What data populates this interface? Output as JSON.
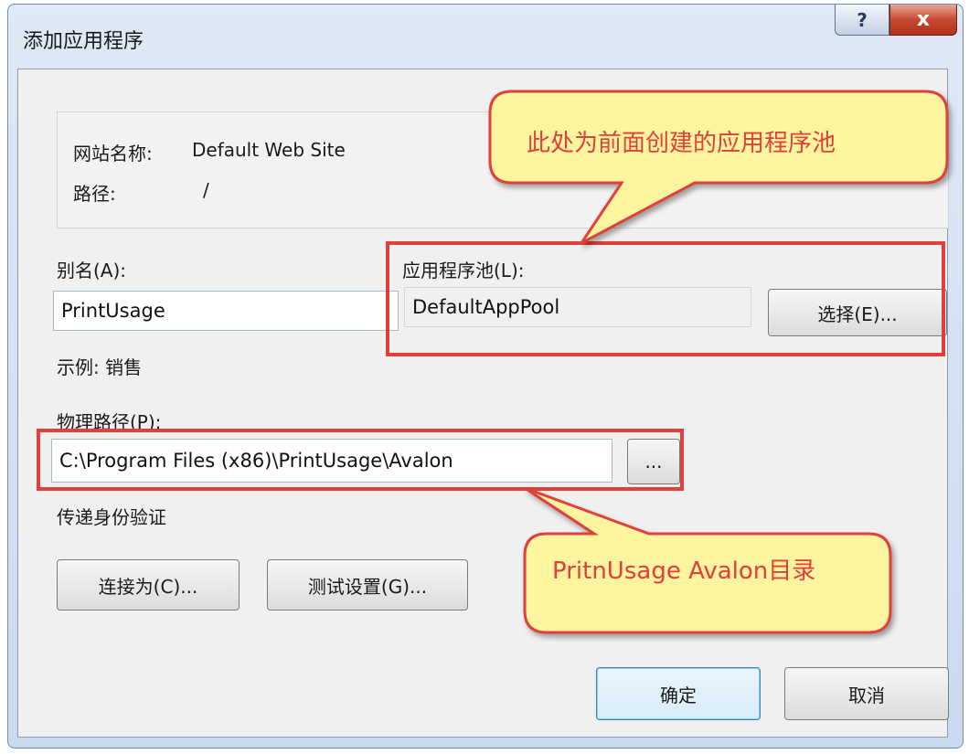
{
  "window": {
    "title": "添加应用程序",
    "help_label": "?",
    "close_label": "x"
  },
  "site": {
    "name_label": "网站名称:",
    "name_value": "Default Web Site",
    "path_label": "路径:",
    "path_value": "/"
  },
  "alias": {
    "label": "别名(A):",
    "value": "PrintUsage",
    "example": "示例: 销售"
  },
  "app_pool": {
    "label": "应用程序池(L):",
    "value": "DefaultAppPool",
    "select_button": "选择(E)..."
  },
  "physical_path": {
    "label": "物理路径(P):",
    "value": "C:\\Program Files (x86)\\PrintUsage\\Avalon",
    "browse_button": "..."
  },
  "auth": {
    "label": "传递身份验证",
    "connect_as_button": "连接为(C)...",
    "test_settings_button": "测试设置(G)..."
  },
  "footer": {
    "ok_button": "确定",
    "cancel_button": "取消"
  },
  "annotations": {
    "pool_callout": "此处为前面创建的应用程序池",
    "path_callout": "PritnUsage  Avalon目录",
    "colors": {
      "callout_fill": "#fdf4a0",
      "callout_border": "#e0403a",
      "highlight_border": "#e0403a"
    }
  }
}
